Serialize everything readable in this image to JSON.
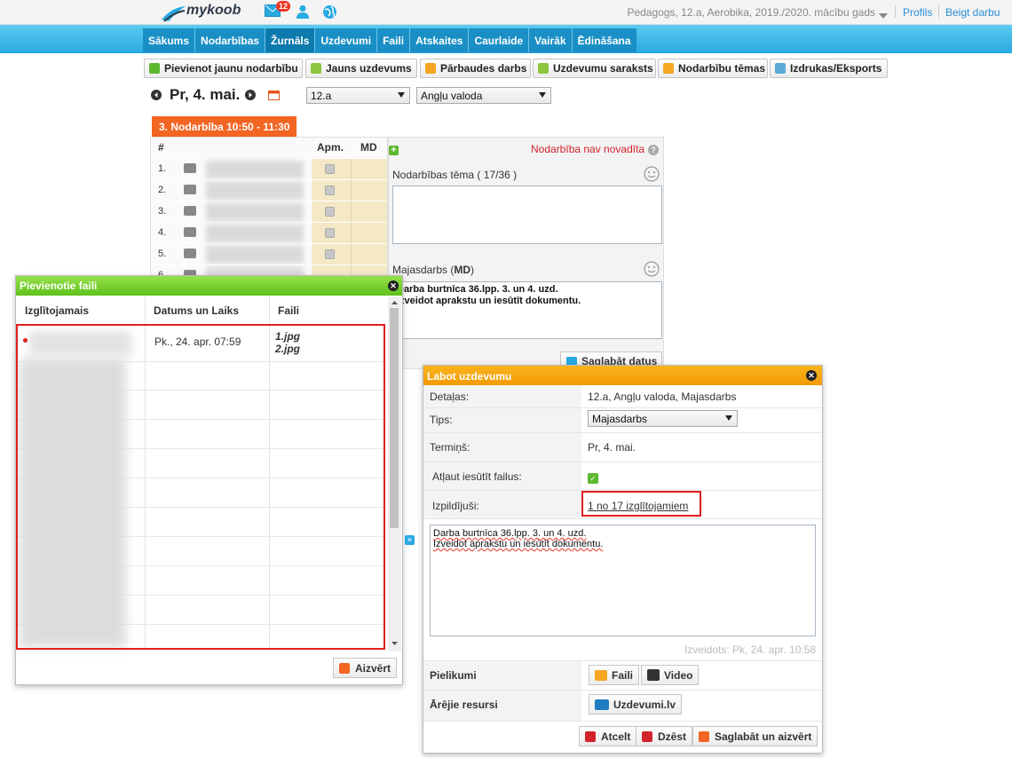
{
  "header": {
    "logo_text": "mykoob",
    "mail_count": "12",
    "user_info": "Pedagogs, 12.a, Aerobika, 2019./2020. mācību gads",
    "profile": "Profils",
    "logout": "Beigt darbu"
  },
  "nav": [
    "Sākums",
    "Nodarbības",
    "Žurnāls",
    "Uzdevumi",
    "Faili",
    "Atskaites",
    "Caurlaide",
    "Vairāk",
    "Ēdināšana"
  ],
  "toolbar": {
    "add_lesson": "Pievienot jaunu nodarbību",
    "new_task": "Jauns uzdevums",
    "test_work": "Pārbaudes darbs",
    "task_list": "Uzdevumu saraksts",
    "topics": "Nodarbību tēmas",
    "print": "Izdrukas/Eksports"
  },
  "date_row": {
    "day": "Pr, 4. mai.",
    "class_select": "12.a",
    "subject_select": "Angļu valoda"
  },
  "lesson": {
    "tab": "3. Nodarbība 10:50 - 11:30",
    "col_num": "#",
    "col_apm": "Apm.",
    "col_md": "MD",
    "rows": [
      "1.",
      "2.",
      "3.",
      "4.",
      "5.",
      "6."
    ],
    "not_held": "Nodarbība nav novadīta",
    "topic_label": "Nodarbības tēma ( 17/36 )",
    "hw_label_prefix": "Majasdarbs (",
    "hw_label_bold": "MD",
    "hw_label_suffix": ")",
    "hw_line1": "Darba burtnīca 36.lpp. 3. un 4. uzd.",
    "hw_line2": "Izveidot aprakstu un iesūtīt dokumentu.",
    "save": "Saglabāt datus"
  },
  "files_dialog": {
    "title": "Pievienotie faili",
    "col_student": "Izglītojamais",
    "col_date": "Datums un Laiks",
    "col_files": "Faili",
    "date": "Pk., 24. apr. 07:59",
    "file1": "1.jpg",
    "file2": "2.jpg",
    "close": "Aizvērt"
  },
  "edit_dialog": {
    "title": "Labot uzdevumu",
    "details_label": "Detaļas:",
    "details_value": "12.a, Angļu valoda, Majasdarbs",
    "type_label": "Tips:",
    "type_value": "Majasdarbs",
    "deadline_label": "Termiņš:",
    "deadline_value": "Pr, 4. mai.",
    "allow_label": "Atļaut iesūtīt failus:",
    "done_label": "Izpildījuši:",
    "done_value": "1 no 17 izglītojamiem",
    "text_line1": "Darba burtnīca 36.lpp. 3. un 4. uzd.",
    "text_line2": "Izveidot aprakstu un iesūtīt dokumentu.",
    "created": "Izveidots: Pk, 24. apr. 10:58",
    "attachments_label": "Pielikumi",
    "files_btn": "Faili",
    "video_btn": "Video",
    "external_label": "Ārējie resursi",
    "external_btn": "Uzdevumi.lv",
    "cancel": "Atcelt",
    "delete": "Dzēst",
    "save_close": "Saglabāt un aizvērt"
  },
  "colors": {
    "nav_blue": "#27a9e1",
    "orange": "#f26522",
    "green_header": "#5ec11a",
    "orange_header": "#f39a06",
    "highlight_red": "#e1201f"
  }
}
